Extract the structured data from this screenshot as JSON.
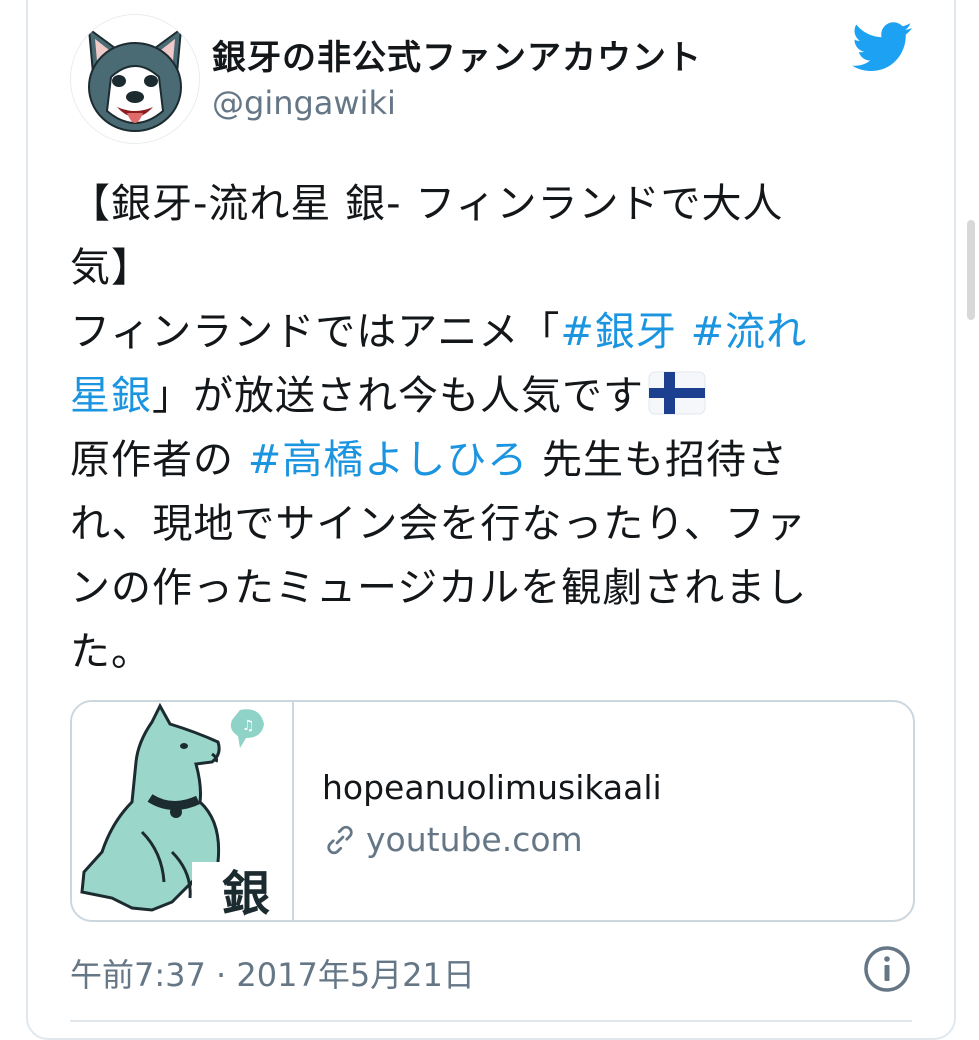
{
  "author": {
    "name": "銀牙の非公式ファンアカウント",
    "handle": "@gingawiki",
    "avatar_icon": "husky-dog-avatar-icon"
  },
  "brand": {
    "icon": "twitter-bird-icon",
    "color": "#1da1f2"
  },
  "tweet": {
    "line1": "【銀牙-流れ星 銀- フィンランドで大人",
    "line2": "気】",
    "line3_text": "フィンランドではアニメ「",
    "line3_tag": "#銀牙 #流れ",
    "line4_tag": "星銀",
    "line4_text": "」が放送され今も人気です",
    "line4_emoji": "finland-flag-icon",
    "line5_text": "原作者の ",
    "line5_tag": "#高橋よしひろ",
    "line5_rest": " 先生も招待さ",
    "line6": "れ、現地でサイン会を行なったり、ファ",
    "line7": "ンの作ったミュージカルを観劇されまし",
    "line8": "た。",
    "hashtag_color": "#1b95e0"
  },
  "link_card": {
    "title": "hopeanuolimusikaali",
    "domain": "youtube.com",
    "thumb_text": "銀",
    "thumb_icon": "dog-illustration-icon"
  },
  "meta": {
    "timestamp": "午前7:37 · 2017年5月21日",
    "info_icon": "info-icon"
  }
}
